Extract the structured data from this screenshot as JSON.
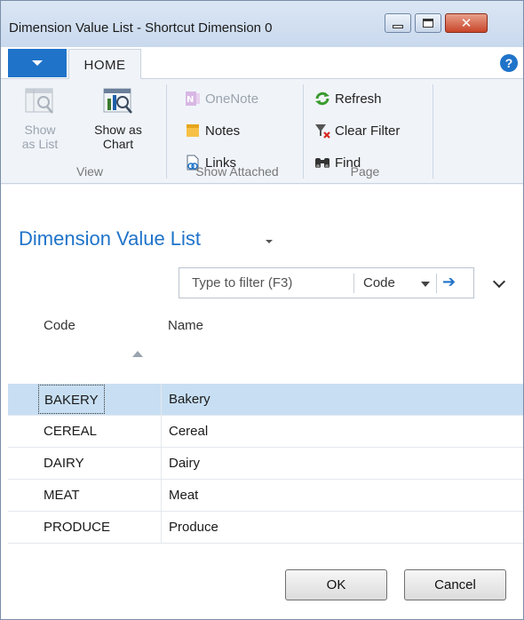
{
  "window": {
    "title": "Dimension Value List - Shortcut Dimension 0"
  },
  "ribbon": {
    "tab": "HOME",
    "groups": [
      {
        "label": "View"
      },
      {
        "label": "Show Attached"
      },
      {
        "label": "Page"
      }
    ],
    "view": {
      "show_as_list_line1": "Show",
      "show_as_list_line2": "as List",
      "show_as_chart_line1": "Show as",
      "show_as_chart_line2": "Chart"
    },
    "attached": {
      "onenote": "OneNote",
      "notes": "Notes",
      "links": "Links"
    },
    "page": {
      "refresh": "Refresh",
      "clear_filter": "Clear Filter",
      "find": "Find"
    }
  },
  "main": {
    "title": "Dimension Value List",
    "filter": {
      "placeholder": "Type to filter (F3)",
      "field": "Code"
    },
    "columns": [
      "Code",
      "Name"
    ],
    "rows": [
      {
        "code": "BAKERY",
        "name": "Bakery",
        "selected": true
      },
      {
        "code": "CEREAL",
        "name": "Cereal",
        "selected": false
      },
      {
        "code": "DAIRY",
        "name": "Dairy",
        "selected": false
      },
      {
        "code": "MEAT",
        "name": "Meat",
        "selected": false
      },
      {
        "code": "PRODUCE",
        "name": "Produce",
        "selected": false
      }
    ]
  },
  "footer": {
    "ok": "OK",
    "cancel": "Cancel"
  },
  "colors": {
    "accent": "#1f73c9",
    "selected_row": "#c8dff3",
    "close_button": "#c9452a"
  }
}
